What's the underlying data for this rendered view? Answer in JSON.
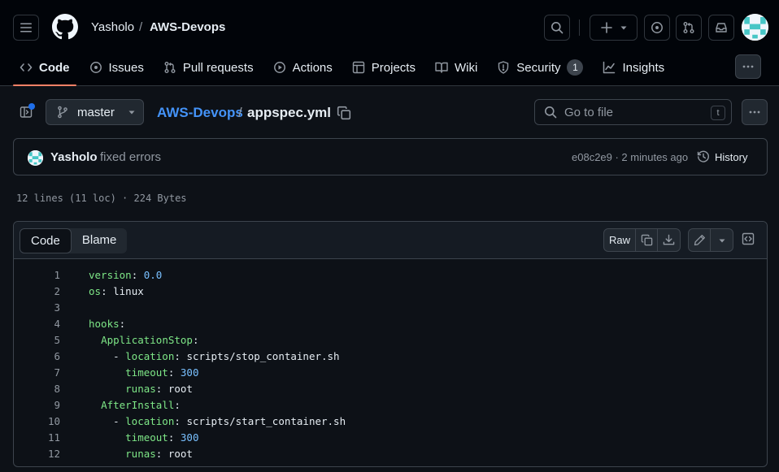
{
  "header": {
    "owner": "Yasholo",
    "separator": "/",
    "repo": "AWS-Devops"
  },
  "tabs": [
    {
      "label": "Code",
      "icon": "code-icon",
      "active": true
    },
    {
      "label": "Issues",
      "icon": "issue-opened-icon"
    },
    {
      "label": "Pull requests",
      "icon": "git-pull-request-icon"
    },
    {
      "label": "Actions",
      "icon": "play-icon"
    },
    {
      "label": "Projects",
      "icon": "table-icon"
    },
    {
      "label": "Wiki",
      "icon": "book-icon"
    },
    {
      "label": "Security",
      "icon": "shield-icon",
      "count": "1"
    },
    {
      "label": "Insights",
      "icon": "graph-icon"
    }
  ],
  "file_nav": {
    "branch": "master",
    "repo_link": "AWS-Devops",
    "separator": "/",
    "filename": "appspec.yml",
    "goto_placeholder": "Go to file",
    "goto_shortcut": "t"
  },
  "commit": {
    "author": "Yasholo",
    "message": "fixed errors",
    "meta": "e08c2e9 · 2 minutes ago",
    "history_label": "History"
  },
  "file_info": "12 lines (11 loc) · 224 Bytes",
  "code_toolbar": {
    "code_tab": "Code",
    "blame_tab": "Blame",
    "raw_label": "Raw"
  },
  "code_lines": [
    {
      "n": "1",
      "indent": "",
      "dash": "",
      "key": "version",
      "value": "0.0",
      "vclass": "v"
    },
    {
      "n": "2",
      "indent": "",
      "dash": "",
      "key": "os",
      "value": "linux",
      "vclass": ""
    },
    {
      "n": "3",
      "indent": "",
      "dash": "",
      "key": "",
      "value": "",
      "vclass": ""
    },
    {
      "n": "4",
      "indent": "",
      "dash": "",
      "key": "hooks",
      "value": "",
      "vclass": ""
    },
    {
      "n": "5",
      "indent": "  ",
      "dash": "",
      "key": "ApplicationStop",
      "value": "",
      "vclass": ""
    },
    {
      "n": "6",
      "indent": "    ",
      "dash": "- ",
      "key": "location",
      "value": "scripts/stop_container.sh",
      "vclass": ""
    },
    {
      "n": "7",
      "indent": "      ",
      "dash": "",
      "key": "timeout",
      "value": "300",
      "vclass": "v"
    },
    {
      "n": "8",
      "indent": "      ",
      "dash": "",
      "key": "runas",
      "value": "root",
      "vclass": ""
    },
    {
      "n": "9",
      "indent": "  ",
      "dash": "",
      "key": "AfterInstall",
      "value": "",
      "vclass": ""
    },
    {
      "n": "10",
      "indent": "    ",
      "dash": "- ",
      "key": "location",
      "value": "scripts/start_container.sh",
      "vclass": ""
    },
    {
      "n": "11",
      "indent": "      ",
      "dash": "",
      "key": "timeout",
      "value": "300",
      "vclass": "v"
    },
    {
      "n": "12",
      "indent": "      ",
      "dash": "",
      "key": "runas",
      "value": "root",
      "vclass": ""
    }
  ],
  "colors": {
    "accent_tab": "#f78166",
    "link": "#4493f8",
    "yaml_key": "#7ee787",
    "yaml_number": "#79c0ff"
  }
}
